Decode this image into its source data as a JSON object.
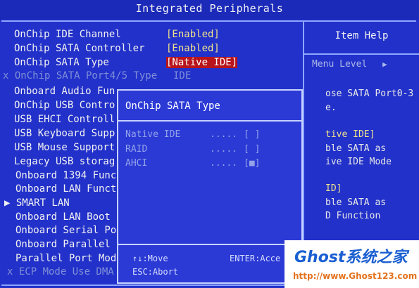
{
  "title": "Integrated Peripherals",
  "menu_items": [
    {
      "label": "OnChip IDE Channel",
      "value": "[Enabled]",
      "state": "normal"
    },
    {
      "label": "OnChip SATA Controller",
      "value": "[Enabled]",
      "state": "normal"
    },
    {
      "label": "OnChip SATA Type",
      "value": "[Native IDE]",
      "state": "selected"
    },
    {
      "label": "x OnChip SATA Port4/5 Type",
      "value": "IDE",
      "state": "dim"
    },
    {
      "label": "Onboard Audio Fun",
      "value": "",
      "state": "normal"
    },
    {
      "label": "OnChip USB Contro",
      "value": "",
      "state": "normal"
    },
    {
      "label": "USB EHCI Controll",
      "value": "",
      "state": "normal"
    },
    {
      "label": "USB Keyboard Supp",
      "value": "",
      "state": "normal"
    },
    {
      "label": "USB Mouse Support",
      "value": "",
      "state": "normal"
    },
    {
      "label": "Legacy USB storag",
      "value": "",
      "state": "normal"
    },
    {
      "label": "Onboard 1394 Func",
      "value": "",
      "state": "normal"
    },
    {
      "label": "Onboard LAN Funct",
      "value": "",
      "state": "normal"
    },
    {
      "label": "▶ SMART LAN",
      "value": "",
      "state": "normal"
    },
    {
      "label": "Onboard LAN Boot",
      "value": "",
      "state": "normal"
    },
    {
      "label": "Onboard Serial Po",
      "value": "",
      "state": "normal"
    },
    {
      "label": "Onboard Parallel",
      "value": "",
      "state": "normal"
    },
    {
      "label": "Parallel Port Mod",
      "value": "",
      "state": "normal"
    },
    {
      "label": "x ECP Mode Use DMA",
      "value": "",
      "state": "dim"
    }
  ],
  "help": {
    "header": "Item Help",
    "menu_level": "Menu Level",
    "menu_level_arrow": "▶",
    "lines": [
      {
        "text": "ose SATA Port0-3",
        "yellow": false
      },
      {
        "text": "e.",
        "yellow": false
      },
      {
        "text": "tive IDE]",
        "yellow": true
      },
      {
        "text": "ble SATA as",
        "yellow": false
      },
      {
        "text": "ive IDE Mode",
        "yellow": false
      },
      {
        "text": "ID]",
        "yellow": true
      },
      {
        "text": "ble SATA as",
        "yellow": false
      },
      {
        "text": "D Function",
        "yellow": false
      }
    ]
  },
  "popup": {
    "title": "OnChip SATA Type",
    "options": [
      {
        "label": "Native IDE",
        "dots": ".....",
        "mark": "[ ]"
      },
      {
        "label": "RAID",
        "dots": ".....",
        "mark": "[ ]"
      },
      {
        "label": "AHCI",
        "dots": ".....",
        "mark": "[■]"
      }
    ],
    "footer": {
      "move": "↑↓:Move",
      "enter": "ENTER:Acce",
      "abort": "ESC:Abort"
    }
  },
  "watermark": {
    "title": "Ghost系统之家",
    "url": "http://www.Ghost123.com"
  }
}
